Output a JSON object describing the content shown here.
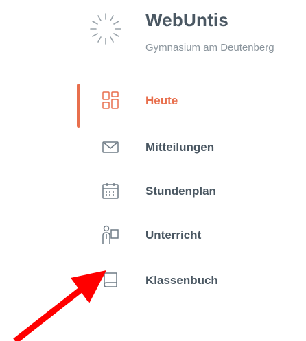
{
  "app": {
    "title": "WebUntis",
    "school": "Gymnasium am Deutenberg"
  },
  "nav": {
    "items": [
      {
        "label": "Heute",
        "icon": "dashboard-icon",
        "active": true
      },
      {
        "label": "Mitteilungen",
        "icon": "envelope-icon",
        "active": false
      },
      {
        "label": "Stundenplan",
        "icon": "calendar-icon",
        "active": false
      },
      {
        "label": "Unterricht",
        "icon": "teacher-icon",
        "active": false
      },
      {
        "label": "Klassenbuch",
        "icon": "book-icon",
        "active": false
      }
    ]
  },
  "colors": {
    "accent": "#e86f4d",
    "text": "#4a5762",
    "muted": "#8a949c",
    "icon": "#6f7b85",
    "annotation_arrow": "#ff0000"
  }
}
